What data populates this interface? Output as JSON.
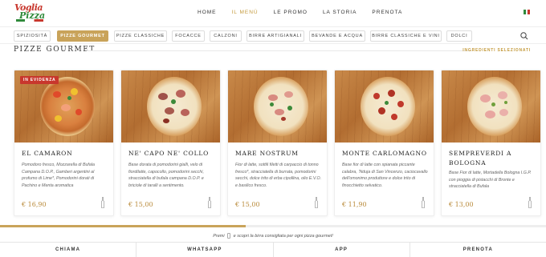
{
  "header": {
    "logo_line1": "Voglia",
    "logo_line2": "Pizza",
    "nav": [
      "HOME",
      "IL MENÙ",
      "LE PROMO",
      "LA STORIA",
      "PRENOTA"
    ],
    "active_nav": "IL MENÙ",
    "flag_colors": [
      "#2f8a3b",
      "#ffffff",
      "#c8372d"
    ]
  },
  "categories": {
    "items": [
      "SPIZIOSITÀ",
      "PIZZE GOURMET",
      "PIZZE CLASSICHE",
      "FOCACCE",
      "CALZONI",
      "BIRRE ARTIGIANALI",
      "BEVANDE E ACQUA",
      "BIRRE CLASSICHE E VINI",
      "DOLCI"
    ],
    "active": "PIZZE GOURMET",
    "search_icon": "search-icon"
  },
  "section": {
    "title": "PIZZE GOURMET",
    "right_label": "INGREDIENTI SELEZIONATI"
  },
  "cards": [
    {
      "badge": "IN EVIDENZA",
      "name": "EL CAMARON",
      "desc": "Pomodoro fresco, Mozzarella di Bufala Campana D.O.P., Gamberi argentini al profumo di Lime*, Pomodorini dorati di Pachino e Menta aromatica",
      "price": "€ 16,90"
    },
    {
      "badge": "",
      "name": "NE' CAPO NE' COLLO",
      "desc": "Base dorata di pomodorini gialli, velo di fiordilatte, capocollo, pomodorini secchi, stracciatella di bufala campana D.O.P. e briciole di taralli a sentimento.",
      "price": "€ 15,00"
    },
    {
      "badge": "",
      "name": "MARE NOSTRUM",
      "desc": "Fior di latte, sottili filetti di carpaccio di tonno fresco*, stracciatella di burrata, pomodorini secchi, dolce trito di erba cipollina, olio E.V.O. e basilico fresco.",
      "price": "€ 15,00"
    },
    {
      "badge": "",
      "name": "MONTE CARLOMAGNO",
      "desc": "Base fior di latte con spianata piccante calabra, 'Nduja di San Vincenzo, caciocavallo dell'omonimo produttore e dolce trito di finocchietto selvatico.",
      "price": "€ 11,90"
    },
    {
      "badge": "",
      "name": "SEMPREVERDI A BOLOGNA",
      "desc": "Base Fior di latte, Mortadella Bologna I.G.P. con pioggia di pistacchi di Bronte e stracciatella di Bufala",
      "price": "€ 13,00"
    }
  ],
  "hint": {
    "before": "Premi",
    "after": "e scopri la birra consigliata per ogni pizza gourmet!"
  },
  "scroll_progress": 0.45,
  "bottom_bar": [
    "CHIAMA",
    "WHATSAPP",
    "APP",
    "PRENOTA"
  ],
  "colors": {
    "accent_gold": "#c9a35a",
    "badge_red": "#c8372d"
  }
}
